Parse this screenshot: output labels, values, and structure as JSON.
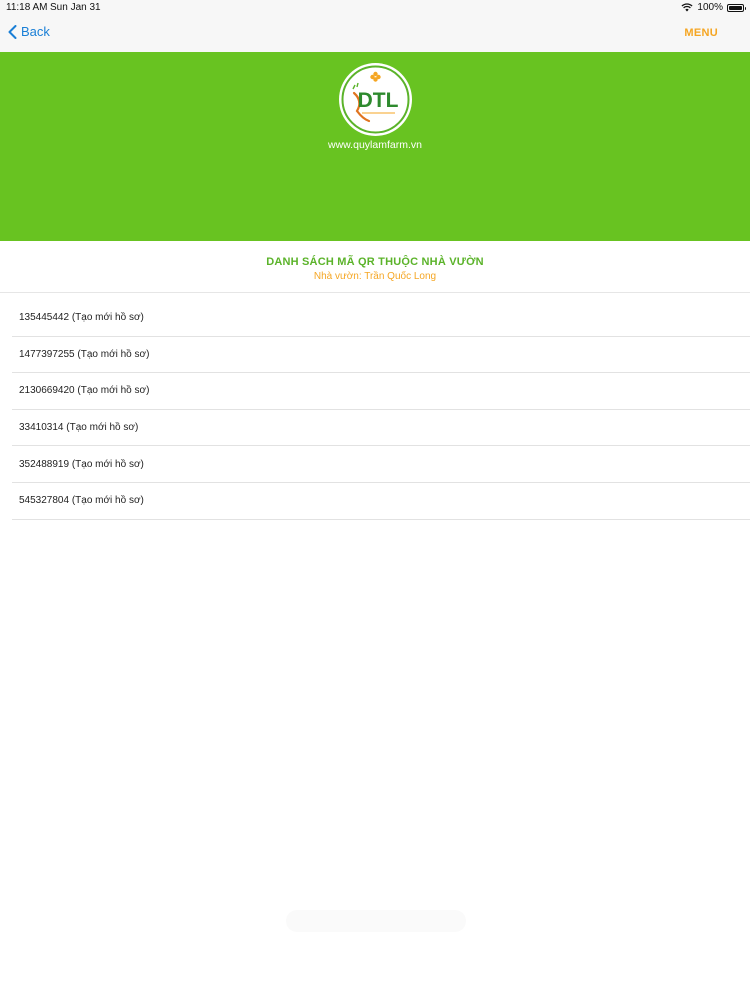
{
  "status_bar": {
    "time": "11:18 AM",
    "date": "Sun Jan 31",
    "battery": "100%",
    "wifi_icon": "wifi-icon",
    "battery_icon": "battery-icon"
  },
  "nav": {
    "back_label": "Back",
    "menu_label": "MENU",
    "back_icon": "chevron-left-icon"
  },
  "hero": {
    "logo_text": "DTL",
    "website": "www.quylamfarm.vn"
  },
  "list": {
    "title": "DANH SÁCH MÃ QR THUỘC NHÀ VƯỜN",
    "subtitle": "Nhà vườn: Trần Quốc Long",
    "items": [
      "135445442 (Tạo mới hồ sơ)",
      "1477397255 (Tạo mới hồ sơ)",
      "2130669420 (Tạo mới hồ sơ)",
      "33410314 (Tạo mới hồ sơ)",
      "352488919 (Tạo mới hồ sơ)",
      "545327804 (Tạo mới hồ sơ)"
    ]
  },
  "colors": {
    "hero_green": "#68c321",
    "title_green": "#5bb32a",
    "accent_orange": "#f5a623",
    "link_blue": "#1a7fd6"
  }
}
